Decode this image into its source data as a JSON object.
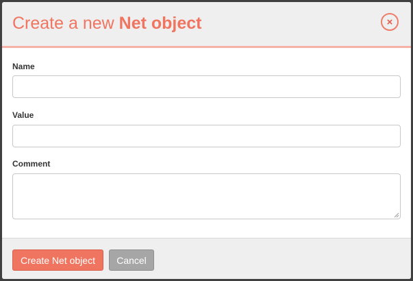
{
  "dialog": {
    "title_prefix": "Create a new ",
    "title_strong": "Net object",
    "close_label": "×"
  },
  "form": {
    "name_label": "Name",
    "name_value": "",
    "value_label": "Value",
    "value_value": "",
    "comment_label": "Comment",
    "comment_value": ""
  },
  "footer": {
    "create_label": "Create Net object",
    "cancel_label": "Cancel"
  },
  "colors": {
    "accent": "#f07561",
    "header_border": "#f6b2a6",
    "cancel": "#a6a6a6",
    "header_bg": "#efefef"
  }
}
